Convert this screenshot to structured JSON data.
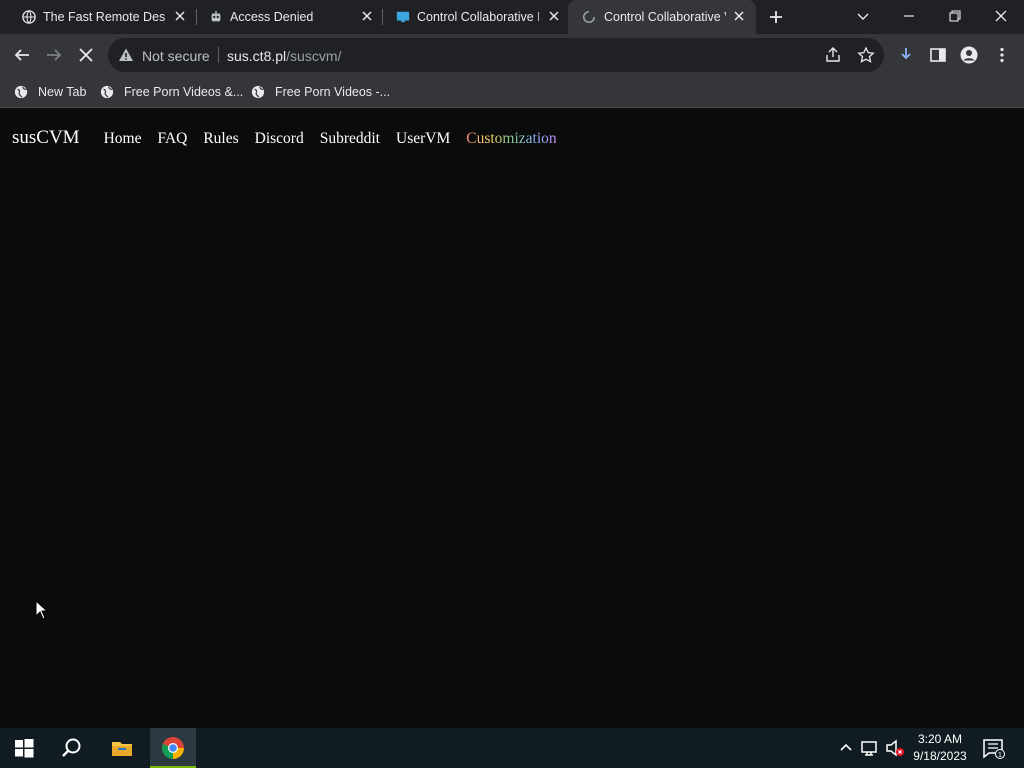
{
  "tabs": [
    {
      "title": "The Fast Remote Deskt",
      "icon": "globe-icon"
    },
    {
      "title": "Access Denied",
      "icon": "robot-icon"
    },
    {
      "title": "Control Collaborative D",
      "icon": "monitor-icon"
    },
    {
      "title": "Control Collaborative V",
      "icon": "loading-icon",
      "active": true
    }
  ],
  "omnibox": {
    "security": "Not secure",
    "host": "sus.ct8.pl",
    "path": "/suscvm/"
  },
  "bookmarks": [
    {
      "label": "New Tab",
      "icon": "globe-icon"
    },
    {
      "label": "Free Porn Videos &...",
      "icon": "globe-icon"
    },
    {
      "label": "Free Porn Videos -...",
      "icon": "globe-icon"
    }
  ],
  "site": {
    "brand": "susCVM",
    "nav": [
      "Home",
      "FAQ",
      "Rules",
      "Discord",
      "Subreddit",
      "UserVM",
      "Customization"
    ]
  },
  "taskbar": {
    "time": "3:20 AM",
    "date": "9/18/2023",
    "notification_count": "1"
  },
  "colors": {
    "tabstrip": "#202124",
    "toolbar": "#35363a",
    "page_bg": "#0b0b0b",
    "taskbar": "#101c22"
  }
}
